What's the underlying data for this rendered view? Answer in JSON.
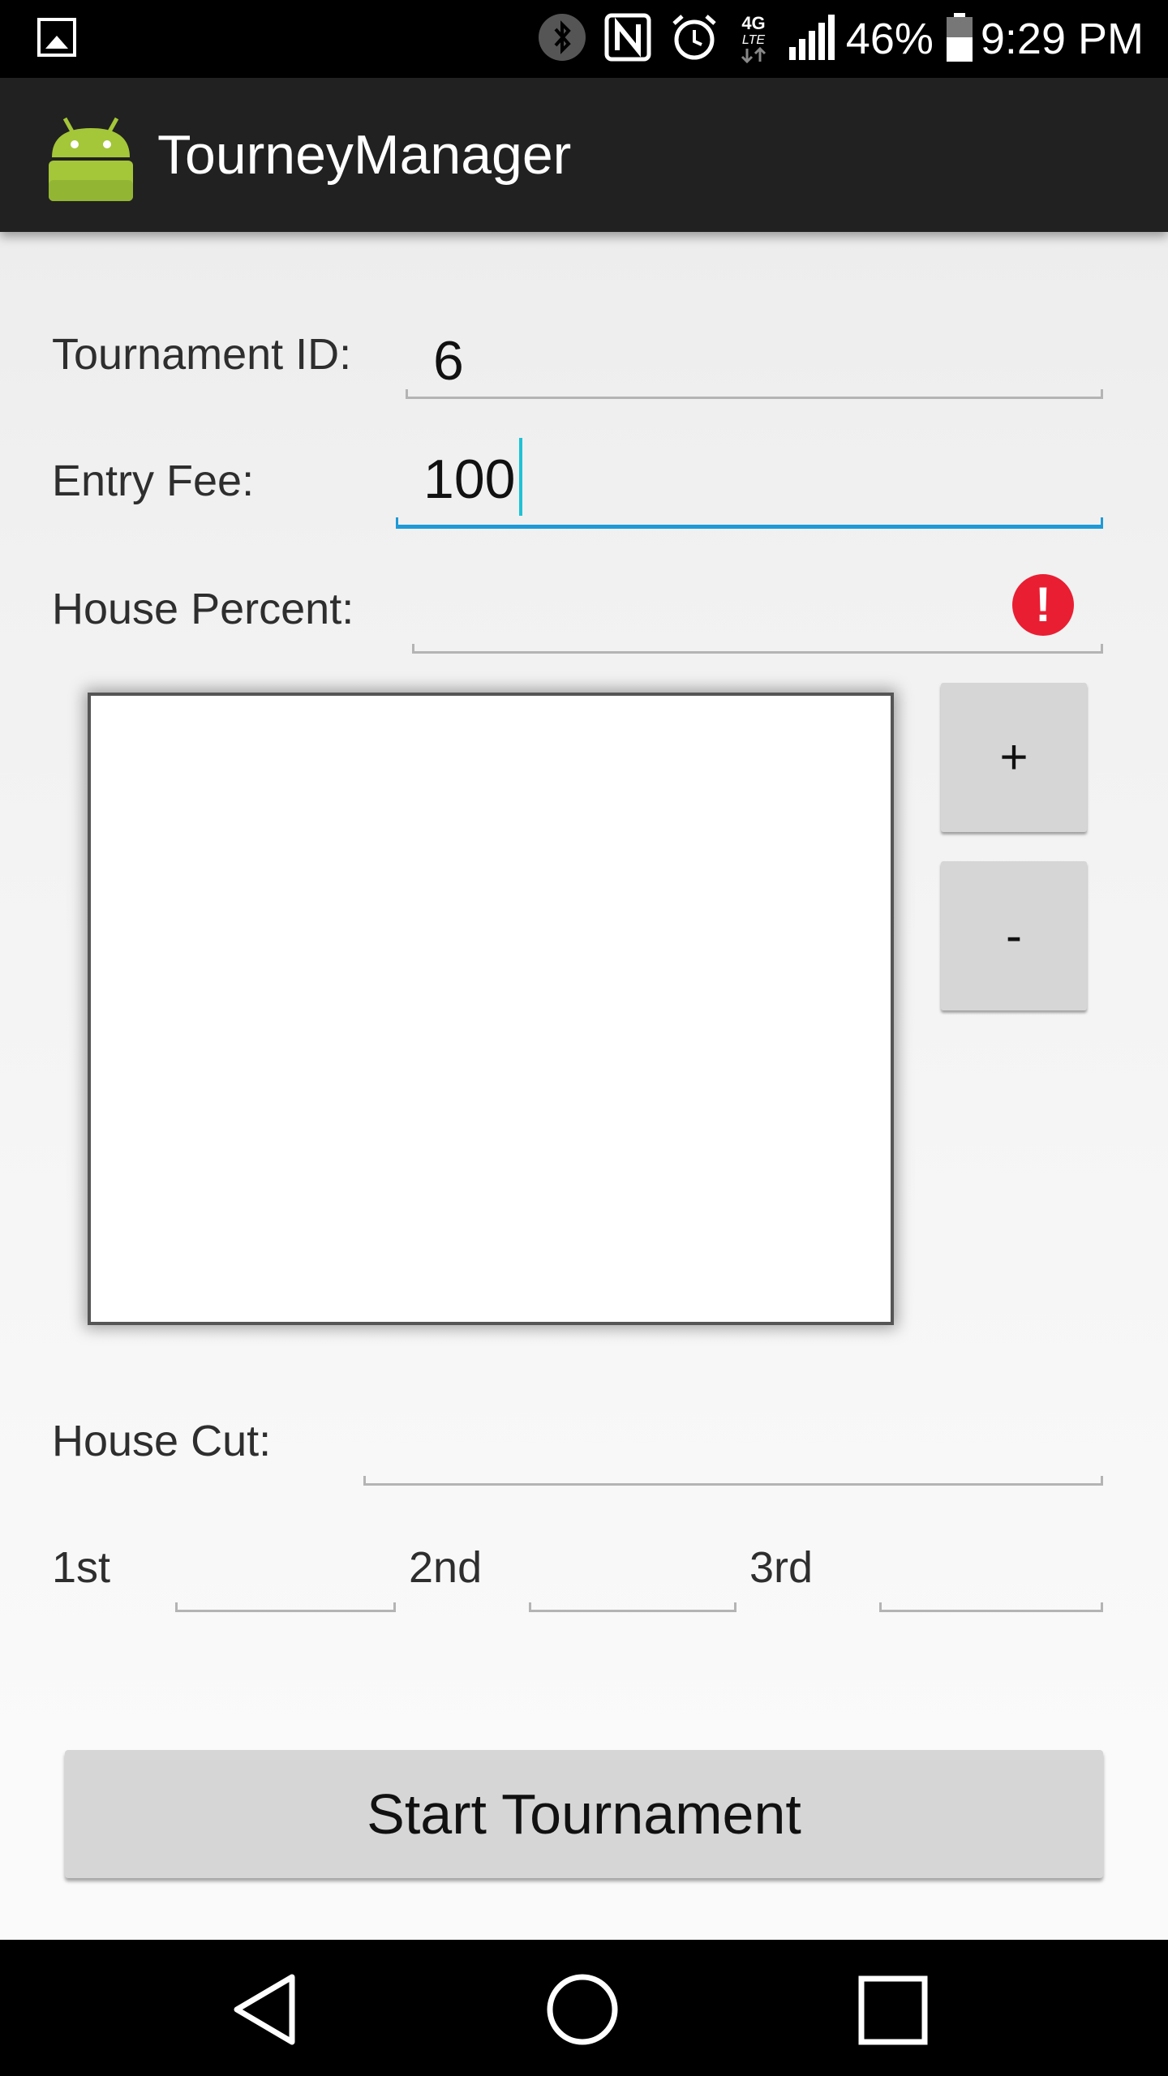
{
  "status_bar": {
    "battery": "46%",
    "time": "9:29 PM",
    "network": "4G LTE",
    "icons": [
      "gallery-icon",
      "bluetooth-icon",
      "nfc-icon",
      "alarm-icon",
      "network-4g-icon",
      "signal-icon",
      "battery-icon"
    ]
  },
  "app_bar": {
    "title": "TourneyManager",
    "icon": "android-icon"
  },
  "form": {
    "tournament_id": {
      "label": "Tournament ID:",
      "value": "6"
    },
    "entry_fee": {
      "label": "Entry Fee:",
      "value": "100"
    },
    "house_percent": {
      "label": "House Percent:",
      "value": "",
      "error_icon": "error-icon"
    },
    "plus_label": "+",
    "minus_label": "-",
    "house_cut": {
      "label": "House Cut:",
      "value": ""
    },
    "places": {
      "first": "1st",
      "second": "2nd",
      "third": "3rd"
    },
    "start_label": "Start Tournament"
  },
  "nav_bar": {
    "icons": [
      "back-icon",
      "home-icon",
      "recents-icon"
    ]
  },
  "colors": {
    "accent": "#1e9ad6",
    "error": "#e91e33",
    "android_green": "#a4c639",
    "action_bar": "#212121"
  }
}
